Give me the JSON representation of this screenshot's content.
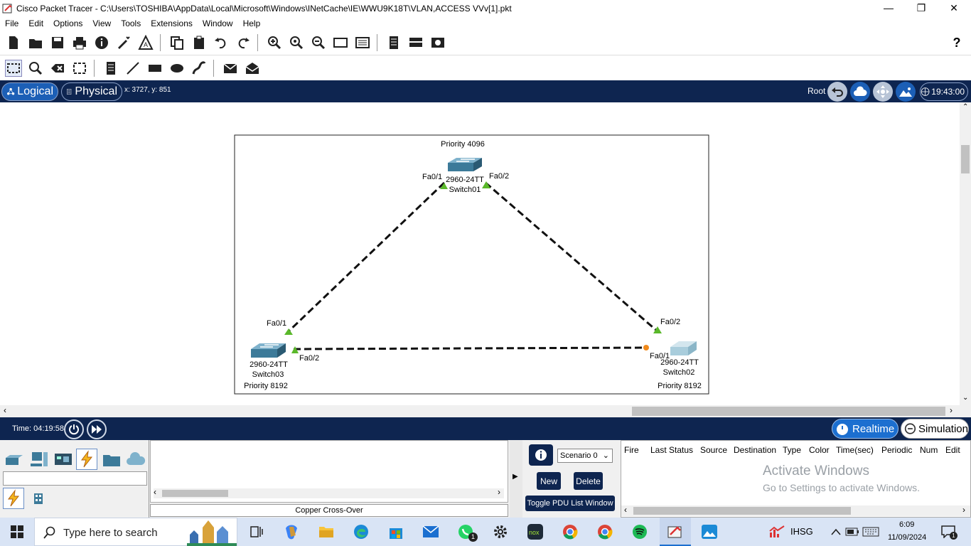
{
  "window": {
    "title": "Cisco Packet Tracer - C:\\Users\\TOSHIBA\\AppData\\Local\\Microsoft\\Windows\\INetCache\\IE\\WWU9K18T\\VLAN,ACCESS VVv[1].pkt"
  },
  "menu": [
    "File",
    "Edit",
    "Options",
    "View",
    "Tools",
    "Extensions",
    "Window",
    "Help"
  ],
  "toolbar": {
    "help_label": "?"
  },
  "nav": {
    "logical_label": "Logical",
    "physical_label": "Physical",
    "coords": "x: 3727, y: 851",
    "root_label": "Root",
    "clock": "19:43:00"
  },
  "topology": {
    "switches": [
      {
        "model": "2960-24TT",
        "name": "Switch01",
        "priority": "Priority 4096"
      },
      {
        "model": "2960-24TT",
        "name": "Switch02",
        "priority": "Priority 8192"
      },
      {
        "model": "2960-24TT",
        "name": "Switch03",
        "priority": "Priority 8192"
      }
    ],
    "ports": {
      "s1_left": "Fa0/1",
      "s1_right": "Fa0/2",
      "s3_top": "Fa0/1",
      "s3_right": "Fa0/2",
      "s2_top": "Fa0/2",
      "s2_left": "Fa0/1"
    },
    "link_colors": {
      "green": "#5ab82a",
      "orange": "#f08a1c"
    }
  },
  "bottom": {
    "time_label": "Time: 04:19:58",
    "realtime_label": "Realtime",
    "simulation_label": "Simulation"
  },
  "panel": {
    "connection_name": "Copper Cross-Over",
    "scenario": "Scenario 0",
    "new_label": "New",
    "delete_label": "Delete",
    "toggle_label": "Toggle PDU List Window",
    "pdu_columns": [
      "Fire",
      "Last Status",
      "Source",
      "Destination",
      "Type",
      "Color",
      "Time(sec)",
      "Periodic",
      "Num",
      "Edit"
    ],
    "watermark_title": "Activate Windows",
    "watermark_sub": "Go to Settings to activate Windows."
  },
  "taskbar": {
    "search_placeholder": "Type here to search",
    "whatsapp_badge": "1",
    "tray_label": "IHSG",
    "time": "6:09",
    "date": "11/09/2024",
    "notif_count": "1"
  }
}
